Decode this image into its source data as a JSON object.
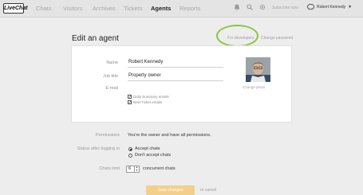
{
  "topbar": {
    "logo": "LiveChat",
    "nav": [
      "Chats",
      "Visitors",
      "Archives",
      "Tickets",
      "Agents",
      "Reports"
    ],
    "active_nav": "Agents",
    "icons": [
      "bell-icon",
      "search-icon",
      "gear-icon"
    ],
    "subscribe": "Subscribe now",
    "user_name": "Robert Kennedy"
  },
  "page": {
    "title": "Edit an agent",
    "for_developers": "For developers",
    "change_password": "Change password"
  },
  "agent": {
    "name_label": "Name",
    "name_value": "Robert Kennedy",
    "job_title_label": "Job title",
    "job_title_value": "Property owner",
    "email_label": "E-mail",
    "email_value": "",
    "change_photo": "Change photo",
    "checkboxes": [
      {
        "label": "Daily Summary emails",
        "checked": true
      },
      {
        "label": "New Ticket emails",
        "checked": true
      }
    ]
  },
  "permissions": {
    "label": "Permissions",
    "text": "You're the owner and have all permissions."
  },
  "status": {
    "label": "Status after logging in",
    "options": [
      {
        "label": "Accept chats",
        "selected": true
      },
      {
        "label": "Don't accept chats",
        "selected": false
      }
    ]
  },
  "chats_limit": {
    "label": "Chats limit",
    "value": "6",
    "suffix": "concurrent chats"
  },
  "actions": {
    "save": "Save changes",
    "cancel": "or cancel"
  },
  "colors": {
    "highlight_ring": "#8cc63f",
    "save_button": "#f3d08a"
  }
}
